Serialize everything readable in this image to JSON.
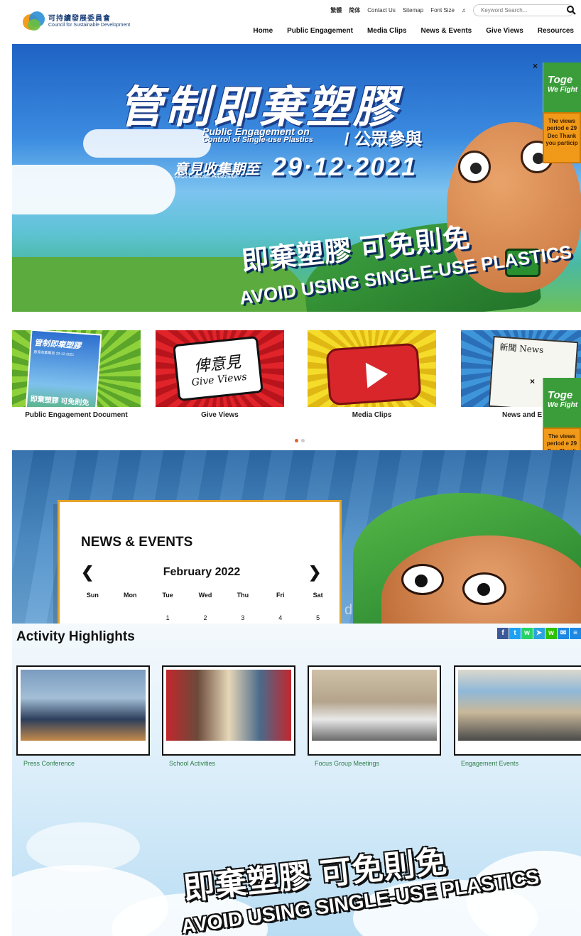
{
  "header": {
    "logo_zh": "可持續發展委員會",
    "logo_en": "Council for Sustainable Development",
    "utility": {
      "lang_tc": "繁體",
      "lang_sc": "简体",
      "contact": "Contact Us",
      "sitemap": "Sitemap",
      "font_size": "Font Size",
      "audio_glyph": "♫"
    },
    "search": {
      "placeholder": "Keyword Search...",
      "value": ""
    },
    "nav": [
      "Home",
      "Public Engagement",
      "Media Clips",
      "News & Events",
      "Give Views",
      "Resources"
    ]
  },
  "hero": {
    "title_zh": "管制即棄塑膠",
    "sub_en_1": "Public Engagement on",
    "sub_en_2": "Control of Single-use Plastics",
    "sub_zh": "/ 公眾參與",
    "period_zh": "意見收集期至",
    "period_en": "Views Collection Period until",
    "date": "29·12·2021",
    "slogan_zh": "即棄塑膠 可免則免",
    "slogan_en": "AVOID USING SINGLE-USE PLASTICS"
  },
  "side_banner": {
    "close": "×",
    "line1": "Toge",
    "line2": "We Fight",
    "notice": "The views period e 29 Dec Thank you particip"
  },
  "quick_links": [
    {
      "label": "Public Engagement Document"
    },
    {
      "label": "Give Views",
      "art_zh": "俾意見",
      "art_en": "Give Views"
    },
    {
      "label": "Media Clips"
    },
    {
      "label": "News and E",
      "art_zh": "新聞 News"
    }
  ],
  "doc_cover": {
    "title_zh": "管制即棄塑膠",
    "slogan_zh": "即棄塑膠 可免則免",
    "date": "意見收集期至 29-12-2021"
  },
  "news": {
    "title": "NEWS & EVENTS",
    "prev": "❮",
    "next": "❯",
    "month": "February 2022",
    "weekdays": [
      "Sun",
      "Mon",
      "Tue",
      "Wed",
      "Thu",
      "Fri",
      "Sat"
    ],
    "week1": [
      "",
      "",
      "1",
      "2",
      "3",
      "4",
      "5"
    ],
    "bg_text": "duce"
  },
  "activity": {
    "title": "Activity Highlights",
    "share": [
      {
        "icon": "facebook-icon",
        "glyph": "f",
        "color": "#3b5998"
      },
      {
        "icon": "twitter-icon",
        "glyph": "t",
        "color": "#1da1f2"
      },
      {
        "icon": "whatsapp-icon",
        "glyph": "w",
        "color": "#25d366"
      },
      {
        "icon": "telegram-icon",
        "glyph": "➤",
        "color": "#2aa3df"
      },
      {
        "icon": "wechat-icon",
        "glyph": "w",
        "color": "#2dc100"
      },
      {
        "icon": "email-icon",
        "glyph": "✉",
        "color": "#1e88e5"
      },
      {
        "icon": "more-icon",
        "glyph": "≡",
        "color": "#1e88e5"
      }
    ],
    "items": [
      {
        "label": "Press Conference"
      },
      {
        "label": "School Activities"
      },
      {
        "label": "Focus Group Meetings"
      },
      {
        "label": "Engagement Events"
      }
    ]
  },
  "footer_banner": {
    "slogan_zh": "即棄塑膠 可免則免",
    "slogan_en": "AVOID USING SINGLE-USE PLASTICS"
  }
}
